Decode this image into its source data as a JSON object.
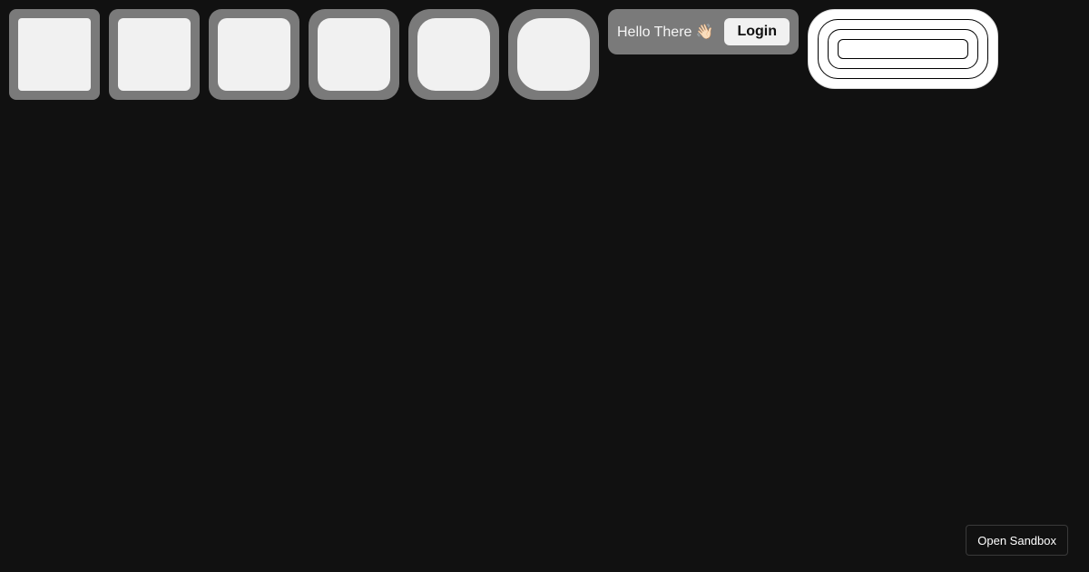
{
  "tiles": [
    {
      "name": "tile-1"
    },
    {
      "name": "tile-2"
    },
    {
      "name": "tile-3"
    },
    {
      "name": "tile-4"
    },
    {
      "name": "tile-5"
    },
    {
      "name": "tile-6"
    }
  ],
  "greeting": {
    "text": "Hello There 👋🏻",
    "login_label": "Login"
  },
  "rings": {
    "input_value": "",
    "input_placeholder": ""
  },
  "footer": {
    "sandbox_label": "Open Sandbox"
  },
  "colors": {
    "background": "#111111",
    "tile_frame": "#7a7a7a",
    "tile_fill": "#f1f1f1",
    "panel_white": "#ffffff"
  }
}
